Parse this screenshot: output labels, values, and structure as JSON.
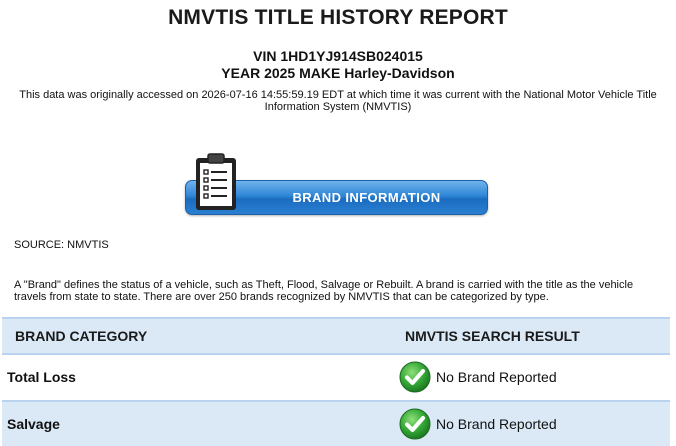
{
  "report": {
    "title": "NMVTIS TITLE HISTORY REPORT",
    "vin_line": "VIN 1HD1YJ914SB024015",
    "year_make_line": "YEAR 2025 MAKE Harley-Davidson",
    "access_note": "This data was originally accessed on 2026-07-16 14:55:59.19 EDT at which time it was current with the National Motor Vehicle Title Information System (NMVTIS)"
  },
  "banner": {
    "label": "BRAND INFORMATION",
    "icon": "clipboard-checklist-icon"
  },
  "source": "SOURCE: NMVTIS",
  "description": "A \"Brand\" defines the status of a vehicle, such as Theft, Flood, Salvage or Rebuilt. A brand is carried with the title as the vehicle travels from state to state. There are over 250 brands recognized by NMVTIS that can be categorized by type.",
  "table": {
    "headers": {
      "category": "BRAND CATEGORY",
      "result": "NMVTIS SEARCH RESULT"
    },
    "rows": [
      {
        "category": "Total Loss",
        "result": "No Brand Reported",
        "icon": "green-check-icon"
      },
      {
        "category": "Salvage",
        "result": "No Brand Reported",
        "icon": "green-check-icon"
      }
    ]
  },
  "colors": {
    "header_bg": "#dbe9f7",
    "banner_blue": "#2f86d6",
    "check_green": "#2ea043"
  }
}
